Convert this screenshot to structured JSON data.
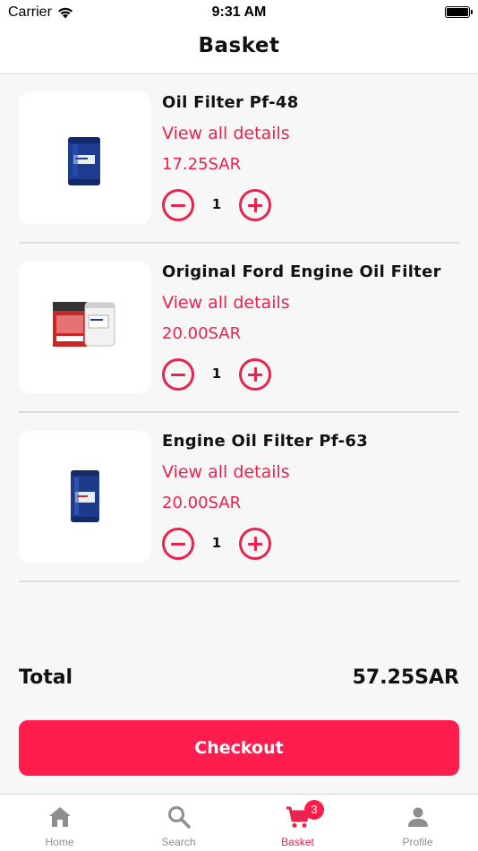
{
  "status_bar": {
    "carrier": "Carrier",
    "time": "9:31 AM"
  },
  "header": {
    "title": "Basket"
  },
  "cart": {
    "items": [
      {
        "name": "Oil Filter Pf-48",
        "details_label": "View all details",
        "price": "17.25SAR",
        "quantity": "1",
        "image_icon": "oil-filter-blue-icon"
      },
      {
        "name": "Original Ford Engine Oil Filter",
        "details_label": "View all details",
        "price": "20.00SAR",
        "quantity": "1",
        "image_icon": "oil-filter-box-icon"
      },
      {
        "name": "Engine Oil Filter Pf-63",
        "details_label": "View all details",
        "price": "20.00SAR",
        "quantity": "1",
        "image_icon": "oil-filter-tall-blue-icon"
      }
    ],
    "total_label": "Total",
    "total_value": "57.25SAR",
    "checkout_label": "Checkout"
  },
  "tab_bar": {
    "tabs": [
      {
        "label": "Home",
        "icon": "home-icon"
      },
      {
        "label": "Search",
        "icon": "search-icon"
      },
      {
        "label": "Basket",
        "icon": "cart-icon",
        "active": true,
        "badge": "3"
      },
      {
        "label": "Profile",
        "icon": "person-icon"
      }
    ]
  },
  "colors": {
    "accent": "#e8234d",
    "button": "#ff1d4e",
    "background": "#f7f7f7",
    "inactive_tab": "#8e8e8e"
  }
}
